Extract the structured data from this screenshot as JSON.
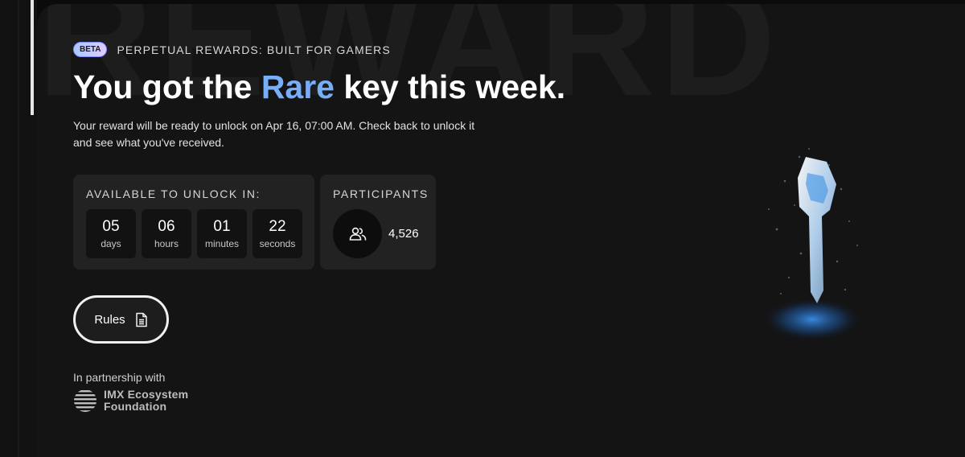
{
  "watermark": {
    "text": "REWARD"
  },
  "hero": {
    "beta_badge": "BETA",
    "tagline": "PERPETUAL REWARDS: BUILT FOR GAMERS",
    "headline_before": "You got the ",
    "headline_highlight": "Rare",
    "headline_after": " key this week.",
    "description": "Your reward will be ready to unlock on Apr 16, 07:00 AM. Check back to unlock it and see what you've received.",
    "highlight_color": "#76aef8"
  },
  "countdown": {
    "title": "AVAILABLE TO UNLOCK IN:",
    "units": [
      {
        "value": "05",
        "label": "days"
      },
      {
        "value": "06",
        "label": "hours"
      },
      {
        "value": "01",
        "label": "minutes"
      },
      {
        "value": "22",
        "label": "seconds"
      }
    ]
  },
  "participants": {
    "title": "PARTICIPANTS",
    "count": "4,526",
    "icon": "users-icon"
  },
  "rules": {
    "label": "Rules",
    "icon": "document-icon"
  },
  "partnership": {
    "label": "In partnership with",
    "partner_line1": "IMX Ecosystem",
    "partner_line2": "Foundation",
    "logo": "imx-logo-icon"
  },
  "reward_visual": {
    "icon": "rare-key-icon",
    "accent": "#3b8ee8"
  }
}
